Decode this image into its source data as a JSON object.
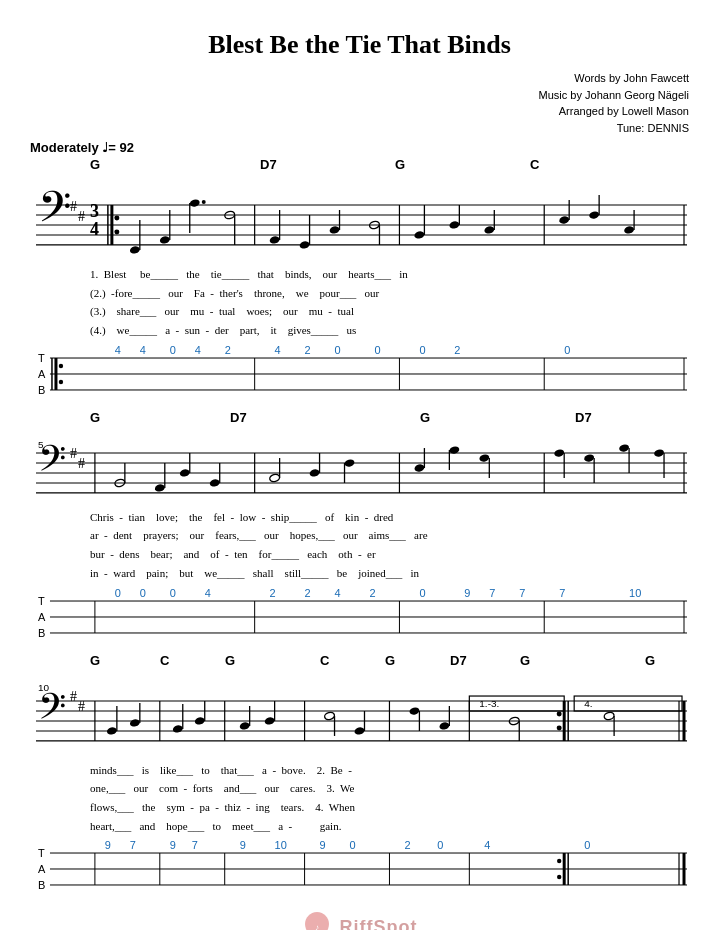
{
  "title": "Blest Be the Tie That Binds",
  "credits": {
    "words": "Words by John Fawcett",
    "music": "Music by Johann Georg Nägeli",
    "arranged": "Arranged by Lowell Mason",
    "tune": "Tune: DENNIS"
  },
  "tempo": {
    "label": "Moderately",
    "bpm": "♩= 92"
  },
  "sections": [
    {
      "measure_start": 1,
      "chords": [
        "G",
        "",
        "",
        "",
        "D7",
        "",
        "G",
        "",
        "C",
        ""
      ],
      "lyrics": [
        "1. Blest   be_____   the   tie_____   that   binds,   our   hearts___   in",
        "(2.) -fore_____   our   Fa  -  ther's   throne,   we   pour___   our",
        "(3.)   share___   our   mu  -  tual   woes;   our   mu  -  tual",
        "(4.)   we_____   a  -  sun  -  der   part,   it   gives_____   us"
      ],
      "tab": "T 4  :  4  0  4  2  2  0  0  0  2  0\nA\nB  :  ."
    },
    {
      "measure_start": 5,
      "chords": [
        "G",
        "",
        "D7",
        "",
        "",
        "",
        "G",
        "",
        "D7",
        ""
      ],
      "lyrics": [
        "Chris - tian   love;   the   fel - low - ship_____   of   kin - dred",
        "ar - dent   prayers;   our   fears,___   our   hopes,___   our   aims___   are",
        "bur - dens   bear;   and   of - ten   for_____   each   oth - er",
        "in - ward   pain;   but   we_____   shall   still_____   be   joined___   in"
      ],
      "tab": "T 0  0  0  4  2  2  4  2  0  9  7  7  7  10\nA\nB"
    },
    {
      "measure_start": 10,
      "chords": [
        "G",
        "C",
        "G",
        "",
        "C",
        "G",
        "D7",
        "G",
        "",
        "G"
      ],
      "lyrics": [
        "minds___   is   like___   to   that___   a - bove.   2. Be -",
        "one,___   our   com - forts   and___   our   cares.   3. We",
        "flows,___   the   sym - pa - thiz - ing   tears.   4. When",
        "heart,___   and   hope___   to   meet___   a -   gain."
      ],
      "tab": "T 9  7  9  7  9  10  9  0  2  0  4  :  0\nA\nB"
    }
  ],
  "branding": {
    "name": "RiffSpot",
    "icon": "guitar"
  }
}
